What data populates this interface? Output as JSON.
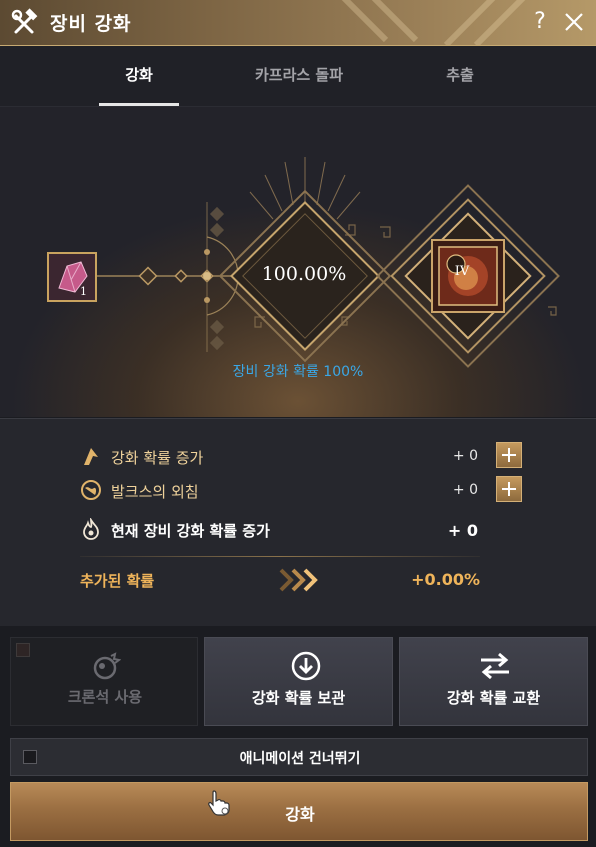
{
  "window": {
    "title": "장비 강화",
    "help_label": "?",
    "icons": {
      "title": "hammer-wrench-icon",
      "close": "close-icon"
    }
  },
  "tabs": [
    {
      "label": "강화",
      "active": true
    },
    {
      "label": "카프라스 돌파",
      "active": false
    },
    {
      "label": "추출",
      "active": false
    }
  ],
  "stage": {
    "material_count": "1",
    "success_rate": "100.00%",
    "target_grade": "IV",
    "probability_text": "장비 강화 확률 100%"
  },
  "stats": {
    "rows": [
      {
        "icon": "up-arrow-icon",
        "label": "강화 확률 증가",
        "value": "+ 0"
      },
      {
        "icon": "globe-icon",
        "label": "발크스의 외침",
        "value": "+ 0"
      },
      {
        "icon": "flame-icon",
        "label": "현재 장비 강화 확률 증가",
        "value": "+ 0"
      }
    ],
    "added_label": "추가된 확률",
    "added_value": "+0.00%"
  },
  "buttons": {
    "chronos": "크론석 사용",
    "store": "강화 확률 보관",
    "swap": "강화 확률 교환",
    "skip_animation": "애니메이션 건너뛰기",
    "enhance": "강화"
  },
  "colors": {
    "accent_gold": "#efb45a",
    "probability_blue": "#3aa7e6",
    "title_bar": "#9a7f57"
  }
}
